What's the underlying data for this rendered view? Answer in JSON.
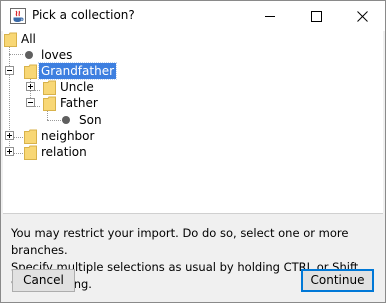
{
  "window": {
    "title": "Pick a collection?"
  },
  "title_bar_buttons": {
    "minimize_icon": "minimize-icon",
    "maximize_icon": "maximize-icon",
    "close_icon": "close-icon"
  },
  "tree": {
    "nodes": [
      {
        "label": "All",
        "type": "folder",
        "state": "expanded-root"
      },
      {
        "label": "loves",
        "type": "leaf"
      },
      {
        "label": "Grandfather",
        "type": "folder",
        "state": "expanded",
        "selected": true
      },
      {
        "label": "Uncle",
        "type": "folder",
        "state": "collapsed"
      },
      {
        "label": "Father",
        "type": "folder",
        "state": "expanded"
      },
      {
        "label": "Son",
        "type": "leaf"
      },
      {
        "label": "neighbor",
        "type": "folder",
        "state": "collapsed"
      },
      {
        "label": "relation",
        "type": "folder",
        "state": "collapsed"
      }
    ]
  },
  "instructions": {
    "line1": "You may restrict your import. Do do so, select one or more branches.",
    "line2": "Specify multiple selections as usual by holding CTRL or Shift while clicking."
  },
  "buttons": {
    "cancel_label": "Cancel",
    "continue_label": "Continue"
  },
  "colors": {
    "selection": "#3d7fe0",
    "folder": "#f8d775",
    "default_button_border": "#0078d7"
  }
}
